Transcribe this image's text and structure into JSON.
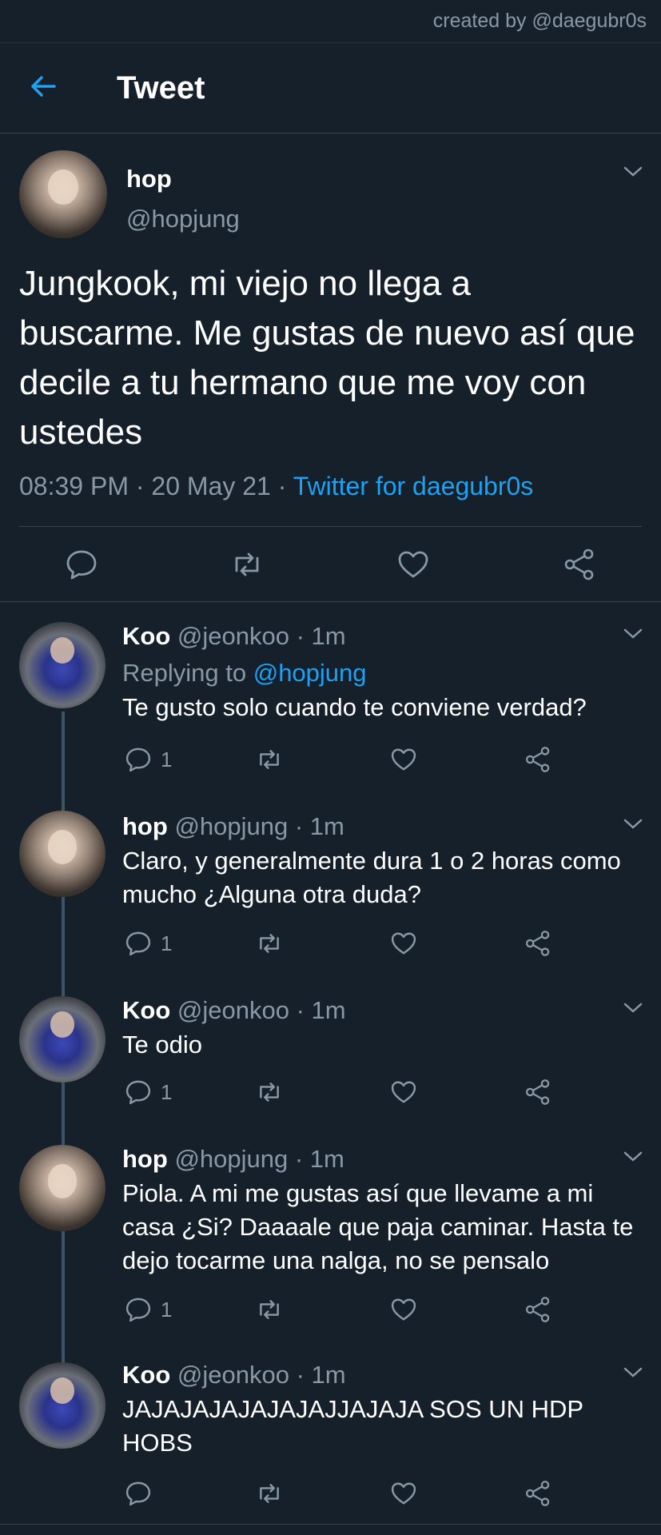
{
  "credit": "created by @daegubr0s",
  "header": {
    "title": "Tweet",
    "back_icon": "arrow-left-icon",
    "accent": "#1da1f2"
  },
  "main_tweet": {
    "name": "hop",
    "handle": "@hopjung",
    "text": "Jungkook, mi viejo no llega a buscarme. Me gustas de nuevo así que decile a tu hermano que me voy con ustedes",
    "meta_prefix": "08:39 PM · 20 May 21 · ",
    "app": "Twitter for daegubr0s",
    "actions": [
      "reply-icon",
      "retweet-icon",
      "like-icon",
      "share-icon"
    ]
  },
  "replies": [
    {
      "name": "Koo",
      "handle": "@jeonkoo",
      "time": "· 1m",
      "replying_label": "Replying to ",
      "replying_to": "@hopjung",
      "text": "Te gusto solo cuando te conviene verdad?",
      "reply_count": "1"
    },
    {
      "name": "hop",
      "handle": "@hopjung",
      "time": "· 1m",
      "text": "Claro, y generalmente dura 1 o 2 horas como mucho ¿Alguna otra duda?",
      "reply_count": "1"
    },
    {
      "name": "Koo",
      "handle": "@jeonkoo",
      "time": "· 1m",
      "text": "Te odio",
      "reply_count": "1"
    },
    {
      "name": "hop",
      "handle": "@hopjung",
      "time": "· 1m",
      "text": "Piola. A mi me gustas así que llevame a mi casa ¿Si? Daaaale que paja caminar. Hasta te dejo tocarme una nalga, no se pensalo",
      "reply_count": "1"
    },
    {
      "name": "Koo",
      "handle": "@jeonkoo",
      "time": "· 1m",
      "text": "JAJAJAJAJAJAJAJJAJAJA SOS UN HDP HOBS",
      "reply_count": ""
    }
  ],
  "colors": {
    "background": "#15202b",
    "secondary_text": "#8899a6",
    "divider": "#38444d",
    "link": "#1da1f2"
  }
}
